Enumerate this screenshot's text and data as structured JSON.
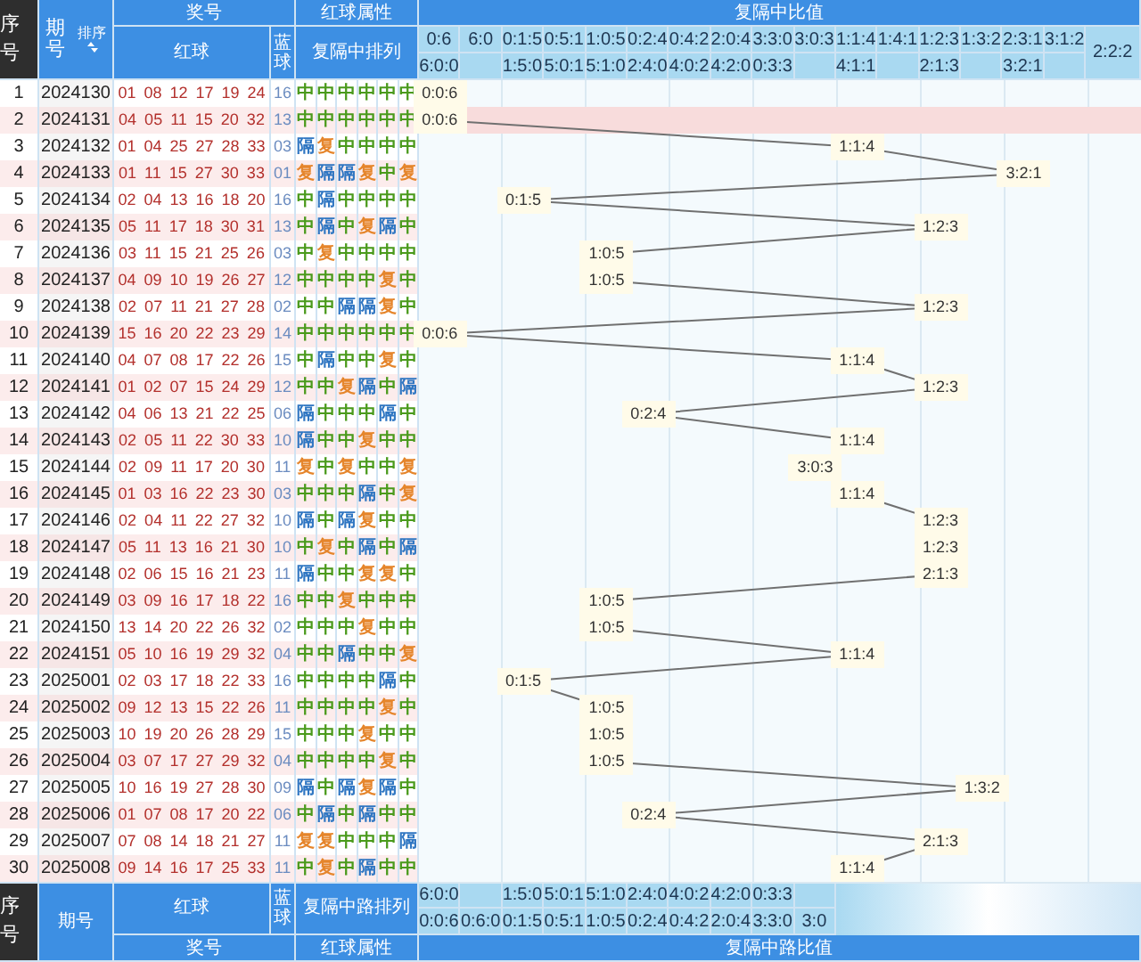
{
  "header": {
    "index_label": "序号",
    "period_label": "期号",
    "sort_label": "排序",
    "prize_label": "奖号",
    "red_attr_label": "红球属性",
    "ratio_label": "复隔中比值",
    "red_label": "红球",
    "blue_label": "蓝球",
    "pattern_label": "复隔中排列",
    "ratio_columns": [
      {
        "top": "0:6",
        "bottom": "6:0:0"
      },
      {
        "top": "6:0"
      },
      {
        "top": "0:1:5",
        "bottom": "1:5:0"
      },
      {
        "top": "0:5:1",
        "bottom": "5:0:1"
      },
      {
        "top": "1:0:5",
        "bottom": "5:1:0"
      },
      {
        "top": "0:2:4",
        "bottom": "2:4:0"
      },
      {
        "top": "0:4:2",
        "bottom": "4:0:2"
      },
      {
        "top": "2:0:4",
        "bottom": "4:2:0"
      },
      {
        "top": "3:3:0",
        "bottom": "0:3:3"
      },
      {
        "top": "3:0:3"
      },
      {
        "top": "1:1:4",
        "bottom": "4:1:1"
      },
      {
        "top": "1:4:1"
      },
      {
        "top": "1:2:3",
        "bottom": "2:1:3"
      },
      {
        "top": "1:3:2"
      },
      {
        "top": "2:3:1",
        "bottom": "3:2:1"
      },
      {
        "top": "3:1:2"
      },
      {
        "label": "2:2:2"
      }
    ]
  },
  "groups": [
    {
      "rows": [
        {
          "no": "1",
          "period": "2024130",
          "red_balls": "01 08 12 17 19 24",
          "blue_ball": "16",
          "ratio": "0:0:6",
          "highlighted": false,
          "attributes": [
            {
              "label": "中",
              "kind": "zhong"
            },
            {
              "label": "中",
              "kind": "zhong"
            },
            {
              "label": "中",
              "kind": "zhong"
            },
            {
              "label": "中",
              "kind": "zhong"
            },
            {
              "label": "中",
              "kind": "zhong"
            },
            {
              "label": "中",
              "kind": "zhong"
            }
          ]
        },
        {
          "no": "2",
          "period": "2024131",
          "red_balls": "04 05 11 15 20 32",
          "blue_ball": "13",
          "ratio": "0:0:6",
          "highlighted": true,
          "attributes": [
            {
              "label": "中",
              "kind": "zhong"
            },
            {
              "label": "中",
              "kind": "zhong"
            },
            {
              "label": "中",
              "kind": "zhong"
            },
            {
              "label": "中",
              "kind": "zhong"
            },
            {
              "label": "中",
              "kind": "zhong"
            },
            {
              "label": "中",
              "kind": "zhong"
            }
          ]
        },
        {
          "no": "3",
          "period": "2024132",
          "red_balls": "01 04 25 27 28 33",
          "blue_ball": "03",
          "ratio": "1:1:4",
          "highlighted": false,
          "attributes": [
            {
              "label": "隔",
              "kind": "ge"
            },
            {
              "label": "复",
              "kind": "fu"
            },
            {
              "label": "中",
              "kind": "zhong"
            },
            {
              "label": "中",
              "kind": "zhong"
            },
            {
              "label": "中",
              "kind": "zhong"
            },
            {
              "label": "中",
              "kind": "zhong"
            }
          ]
        },
        {
          "no": "4",
          "period": "2024133",
          "red_balls": "01 11 15 27 30 33",
          "blue_ball": "01",
          "ratio": "3:2:1",
          "highlighted": false,
          "attributes": [
            {
              "label": "复",
              "kind": "fu"
            },
            {
              "label": "隔",
              "kind": "ge"
            },
            {
              "label": "隔",
              "kind": "ge"
            },
            {
              "label": "复",
              "kind": "fu"
            },
            {
              "label": "中",
              "kind": "zhong"
            },
            {
              "label": "复",
              "kind": "fu"
            }
          ]
        },
        {
          "no": "5",
          "period": "2024134",
          "red_balls": "02 04 13 16 18 20",
          "blue_ball": "16",
          "ratio": "0:1:5",
          "highlighted": false,
          "attributes": [
            {
              "label": "中",
              "kind": "zhong"
            },
            {
              "label": "隔",
              "kind": "ge"
            },
            {
              "label": "中",
              "kind": "zhong"
            },
            {
              "label": "中",
              "kind": "zhong"
            },
            {
              "label": "中",
              "kind": "zhong"
            },
            {
              "label": "中",
              "kind": "zhong"
            }
          ]
        },
        {
          "no": "6",
          "period": "2024135",
          "red_balls": "05 11 17 18 30 31",
          "blue_ball": "13",
          "ratio": "1:2:3",
          "highlighted": false,
          "attributes": [
            {
              "label": "中",
              "kind": "zhong"
            },
            {
              "label": "隔",
              "kind": "ge"
            },
            {
              "label": "中",
              "kind": "zhong"
            },
            {
              "label": "复",
              "kind": "fu"
            },
            {
              "label": "隔",
              "kind": "ge"
            },
            {
              "label": "中",
              "kind": "zhong"
            }
          ]
        }
      ]
    },
    {
      "rows": [
        {
          "no": "7",
          "period": "2024136",
          "red_balls": "03 11 15 21 25 26",
          "blue_ball": "03",
          "ratio": "1:0:5",
          "highlighted": false,
          "attributes": [
            {
              "label": "中",
              "kind": "zhong"
            },
            {
              "label": "复",
              "kind": "fu"
            },
            {
              "label": "中",
              "kind": "zhong"
            },
            {
              "label": "中",
              "kind": "zhong"
            },
            {
              "label": "中",
              "kind": "zhong"
            },
            {
              "label": "中",
              "kind": "zhong"
            }
          ]
        },
        {
          "no": "8",
          "period": "2024137",
          "red_balls": "04 09 10 19 26 27",
          "blue_ball": "12",
          "ratio": "1:0:5",
          "highlighted": false,
          "attributes": [
            {
              "label": "中",
              "kind": "zhong"
            },
            {
              "label": "中",
              "kind": "zhong"
            },
            {
              "label": "中",
              "kind": "zhong"
            },
            {
              "label": "中",
              "kind": "zhong"
            },
            {
              "label": "复",
              "kind": "fu"
            },
            {
              "label": "中",
              "kind": "zhong"
            }
          ]
        },
        {
          "no": "9",
          "period": "2024138",
          "red_balls": "02 07 11 21 27 28",
          "blue_ball": "02",
          "ratio": "1:2:3",
          "highlighted": false,
          "attributes": [
            {
              "label": "中",
              "kind": "zhong"
            },
            {
              "label": "中",
              "kind": "zhong"
            },
            {
              "label": "隔",
              "kind": "ge"
            },
            {
              "label": "隔",
              "kind": "ge"
            },
            {
              "label": "复",
              "kind": "fu"
            },
            {
              "label": "中",
              "kind": "zhong"
            }
          ]
        },
        {
          "no": "10",
          "period": "2024139",
          "red_balls": "15 16 20 22 23 29",
          "blue_ball": "14",
          "ratio": "0:0:6",
          "highlighted": false,
          "attributes": [
            {
              "label": "中",
              "kind": "zhong"
            },
            {
              "label": "中",
              "kind": "zhong"
            },
            {
              "label": "中",
              "kind": "zhong"
            },
            {
              "label": "中",
              "kind": "zhong"
            },
            {
              "label": "中",
              "kind": "zhong"
            },
            {
              "label": "中",
              "kind": "zhong"
            }
          ]
        },
        {
          "no": "11",
          "period": "2024140",
          "red_balls": "04 07 08 17 22 26",
          "blue_ball": "15",
          "ratio": "1:1:4",
          "highlighted": false,
          "attributes": [
            {
              "label": "中",
              "kind": "zhong"
            },
            {
              "label": "隔",
              "kind": "ge"
            },
            {
              "label": "中",
              "kind": "zhong"
            },
            {
              "label": "中",
              "kind": "zhong"
            },
            {
              "label": "复",
              "kind": "fu"
            },
            {
              "label": "中",
              "kind": "zhong"
            }
          ]
        },
        {
          "no": "12",
          "period": "2024141",
          "red_balls": "01 02 07 15 24 29",
          "blue_ball": "12",
          "ratio": "1:2:3",
          "highlighted": false,
          "attributes": [
            {
              "label": "中",
              "kind": "zhong"
            },
            {
              "label": "中",
              "kind": "zhong"
            },
            {
              "label": "复",
              "kind": "fu"
            },
            {
              "label": "隔",
              "kind": "ge"
            },
            {
              "label": "中",
              "kind": "zhong"
            },
            {
              "label": "隔",
              "kind": "ge"
            }
          ]
        }
      ]
    },
    {
      "rows": [
        {
          "no": "13",
          "period": "2024142",
          "red_balls": "04 06 13 21 22 25",
          "blue_ball": "06",
          "ratio": "0:2:4",
          "highlighted": false,
          "attributes": [
            {
              "label": "隔",
              "kind": "ge"
            },
            {
              "label": "中",
              "kind": "zhong"
            },
            {
              "label": "中",
              "kind": "zhong"
            },
            {
              "label": "中",
              "kind": "zhong"
            },
            {
              "label": "隔",
              "kind": "ge"
            },
            {
              "label": "中",
              "kind": "zhong"
            }
          ]
        },
        {
          "no": "14",
          "period": "2024143",
          "red_balls": "02 05 11 22 30 33",
          "blue_ball": "10",
          "ratio": "1:1:4",
          "highlighted": false,
          "attributes": [
            {
              "label": "隔",
              "kind": "ge"
            },
            {
              "label": "中",
              "kind": "zhong"
            },
            {
              "label": "中",
              "kind": "zhong"
            },
            {
              "label": "复",
              "kind": "fu"
            },
            {
              "label": "中",
              "kind": "zhong"
            },
            {
              "label": "中",
              "kind": "zhong"
            }
          ]
        },
        {
          "no": "15",
          "period": "2024144",
          "red_balls": "02 09 11 17 20 30",
          "blue_ball": "11",
          "ratio": "3:0:3",
          "highlighted": false,
          "attributes": [
            {
              "label": "复",
              "kind": "fu"
            },
            {
              "label": "中",
              "kind": "zhong"
            },
            {
              "label": "复",
              "kind": "fu"
            },
            {
              "label": "中",
              "kind": "zhong"
            },
            {
              "label": "中",
              "kind": "zhong"
            },
            {
              "label": "复",
              "kind": "fu"
            }
          ]
        },
        {
          "no": "16",
          "period": "2024145",
          "red_balls": "01 03 16 22 23 30",
          "blue_ball": "03",
          "ratio": "1:1:4",
          "highlighted": false,
          "attributes": [
            {
              "label": "中",
              "kind": "zhong"
            },
            {
              "label": "中",
              "kind": "zhong"
            },
            {
              "label": "中",
              "kind": "zhong"
            },
            {
              "label": "隔",
              "kind": "ge"
            },
            {
              "label": "中",
              "kind": "zhong"
            },
            {
              "label": "复",
              "kind": "fu"
            }
          ]
        },
        {
          "no": "17",
          "period": "2024146",
          "red_balls": "02 04 11 22 27 32",
          "blue_ball": "10",
          "ratio": "1:2:3",
          "highlighted": false,
          "attributes": [
            {
              "label": "隔",
              "kind": "ge"
            },
            {
              "label": "中",
              "kind": "zhong"
            },
            {
              "label": "隔",
              "kind": "ge"
            },
            {
              "label": "复",
              "kind": "fu"
            },
            {
              "label": "中",
              "kind": "zhong"
            },
            {
              "label": "中",
              "kind": "zhong"
            }
          ]
        },
        {
          "no": "18",
          "period": "2024147",
          "red_balls": "05 11 13 16 21 30",
          "blue_ball": "10",
          "ratio": "1:2:3",
          "highlighted": false,
          "attributes": [
            {
              "label": "中",
              "kind": "zhong"
            },
            {
              "label": "复",
              "kind": "fu"
            },
            {
              "label": "中",
              "kind": "zhong"
            },
            {
              "label": "隔",
              "kind": "ge"
            },
            {
              "label": "中",
              "kind": "zhong"
            },
            {
              "label": "隔",
              "kind": "ge"
            }
          ]
        }
      ]
    },
    {
      "rows": [
        {
          "no": "19",
          "period": "2024148",
          "red_balls": "02 06 15 16 21 23",
          "blue_ball": "11",
          "ratio": "2:1:3",
          "highlighted": false,
          "attributes": [
            {
              "label": "隔",
              "kind": "ge"
            },
            {
              "label": "中",
              "kind": "zhong"
            },
            {
              "label": "中",
              "kind": "zhong"
            },
            {
              "label": "复",
              "kind": "fu"
            },
            {
              "label": "复",
              "kind": "fu"
            },
            {
              "label": "中",
              "kind": "zhong"
            }
          ]
        },
        {
          "no": "20",
          "period": "2024149",
          "red_balls": "03 09 16 17 18 22",
          "blue_ball": "16",
          "ratio": "1:0:5",
          "highlighted": false,
          "attributes": [
            {
              "label": "中",
              "kind": "zhong"
            },
            {
              "label": "中",
              "kind": "zhong"
            },
            {
              "label": "复",
              "kind": "fu"
            },
            {
              "label": "中",
              "kind": "zhong"
            },
            {
              "label": "中",
              "kind": "zhong"
            },
            {
              "label": "中",
              "kind": "zhong"
            }
          ]
        },
        {
          "no": "21",
          "period": "2024150",
          "red_balls": "13 14 20 22 26 32",
          "blue_ball": "02",
          "ratio": "1:0:5",
          "highlighted": false,
          "attributes": [
            {
              "label": "中",
              "kind": "zhong"
            },
            {
              "label": "中",
              "kind": "zhong"
            },
            {
              "label": "中",
              "kind": "zhong"
            },
            {
              "label": "复",
              "kind": "fu"
            },
            {
              "label": "中",
              "kind": "zhong"
            },
            {
              "label": "中",
              "kind": "zhong"
            }
          ]
        },
        {
          "no": "22",
          "period": "2024151",
          "red_balls": "05 10 16 19 29 32",
          "blue_ball": "04",
          "ratio": "1:1:4",
          "highlighted": false,
          "attributes": [
            {
              "label": "中",
              "kind": "zhong"
            },
            {
              "label": "中",
              "kind": "zhong"
            },
            {
              "label": "隔",
              "kind": "ge"
            },
            {
              "label": "中",
              "kind": "zhong"
            },
            {
              "label": "中",
              "kind": "zhong"
            },
            {
              "label": "复",
              "kind": "fu"
            }
          ]
        },
        {
          "no": "23",
          "period": "2025001",
          "red_balls": "02 03 17 18 22 33",
          "blue_ball": "16",
          "ratio": "0:1:5",
          "highlighted": false,
          "attributes": [
            {
              "label": "中",
              "kind": "zhong"
            },
            {
              "label": "中",
              "kind": "zhong"
            },
            {
              "label": "中",
              "kind": "zhong"
            },
            {
              "label": "中",
              "kind": "zhong"
            },
            {
              "label": "隔",
              "kind": "ge"
            },
            {
              "label": "中",
              "kind": "zhong"
            }
          ]
        },
        {
          "no": "24",
          "period": "2025002",
          "red_balls": "09 12 13 15 22 26",
          "blue_ball": "11",
          "ratio": "1:0:5",
          "highlighted": false,
          "attributes": [
            {
              "label": "中",
              "kind": "zhong"
            },
            {
              "label": "中",
              "kind": "zhong"
            },
            {
              "label": "中",
              "kind": "zhong"
            },
            {
              "label": "中",
              "kind": "zhong"
            },
            {
              "label": "复",
              "kind": "fu"
            },
            {
              "label": "中",
              "kind": "zhong"
            }
          ]
        }
      ]
    },
    {
      "rows": [
        {
          "no": "25",
          "period": "2025003",
          "red_balls": "10 19 20 26 28 29",
          "blue_ball": "15",
          "ratio": "1:0:5",
          "highlighted": false,
          "attributes": [
            {
              "label": "中",
              "kind": "zhong"
            },
            {
              "label": "中",
              "kind": "zhong"
            },
            {
              "label": "中",
              "kind": "zhong"
            },
            {
              "label": "复",
              "kind": "fu"
            },
            {
              "label": "中",
              "kind": "zhong"
            },
            {
              "label": "中",
              "kind": "zhong"
            }
          ]
        },
        {
          "no": "26",
          "period": "2025004",
          "red_balls": "03 07 17 27 29 32",
          "blue_ball": "04",
          "ratio": "1:0:5",
          "highlighted": false,
          "attributes": [
            {
              "label": "中",
              "kind": "zhong"
            },
            {
              "label": "中",
              "kind": "zhong"
            },
            {
              "label": "中",
              "kind": "zhong"
            },
            {
              "label": "中",
              "kind": "zhong"
            },
            {
              "label": "复",
              "kind": "fu"
            },
            {
              "label": "中",
              "kind": "zhong"
            }
          ]
        },
        {
          "no": "27",
          "period": "2025005",
          "red_balls": "10 16 19 27 28 30",
          "blue_ball": "09",
          "ratio": "1:3:2",
          "highlighted": false,
          "attributes": [
            {
              "label": "隔",
              "kind": "ge"
            },
            {
              "label": "中",
              "kind": "zhong"
            },
            {
              "label": "隔",
              "kind": "ge"
            },
            {
              "label": "复",
              "kind": "fu"
            },
            {
              "label": "隔",
              "kind": "ge"
            },
            {
              "label": "中",
              "kind": "zhong"
            }
          ]
        },
        {
          "no": "28",
          "period": "2025006",
          "red_balls": "01 07 08 17 20 22",
          "blue_ball": "06",
          "ratio": "0:2:4",
          "highlighted": false,
          "attributes": [
            {
              "label": "中",
              "kind": "zhong"
            },
            {
              "label": "隔",
              "kind": "ge"
            },
            {
              "label": "中",
              "kind": "zhong"
            },
            {
              "label": "隔",
              "kind": "ge"
            },
            {
              "label": "中",
              "kind": "zhong"
            },
            {
              "label": "中",
              "kind": "zhong"
            }
          ]
        },
        {
          "no": "29",
          "period": "2025007",
          "red_balls": "07 08 14 18 21 27",
          "blue_ball": "11",
          "ratio": "2:1:3",
          "highlighted": false,
          "attributes": [
            {
              "label": "复",
              "kind": "fu"
            },
            {
              "label": "复",
              "kind": "fu"
            },
            {
              "label": "中",
              "kind": "zhong"
            },
            {
              "label": "中",
              "kind": "zhong"
            },
            {
              "label": "中",
              "kind": "zhong"
            },
            {
              "label": "隔",
              "kind": "ge"
            }
          ]
        },
        {
          "no": "30",
          "period": "2025008",
          "red_balls": "09 14 16 17 25 33",
          "blue_ball": "11",
          "ratio": "1:1:4",
          "highlighted": false,
          "attributes": [
            {
              "label": "中",
              "kind": "zhong"
            },
            {
              "label": "复",
              "kind": "fu"
            },
            {
              "label": "中",
              "kind": "zhong"
            },
            {
              "label": "隔",
              "kind": "ge"
            },
            {
              "label": "中",
              "kind": "zhong"
            },
            {
              "label": "中",
              "kind": "zhong"
            }
          ]
        }
      ]
    }
  ],
  "footer": {
    "index_label": "序号",
    "period_label": "期号",
    "red_label": "红球",
    "blue_label": "蓝球",
    "pattern_label": "复隔中路排列",
    "prize_label": "奖号",
    "red_attr_label": "红球属性",
    "ratio_label": "复隔中路比值",
    "ratio_columns": [
      {
        "top": "6:0:0",
        "bottom": "0:0:6"
      },
      {
        "bottom": "0:6:0"
      },
      {
        "top": "1:5:0",
        "bottom": "0:1:5"
      },
      {
        "top": "5:0:1",
        "bottom": "0:5:1"
      },
      {
        "top": "5:1:0",
        "bottom": "1:0:5"
      },
      {
        "top": "2:4:0",
        "bottom": "0:2:4"
      },
      {
        "top": "4:0:2",
        "bottom": "0:4:2"
      },
      {
        "top": "4:2:0",
        "bottom": "2:0:4"
      },
      {
        "top": "0:3:3",
        "bottom": "3:3:0"
      },
      {
        "bottom": "3:0"
      }
    ]
  }
}
